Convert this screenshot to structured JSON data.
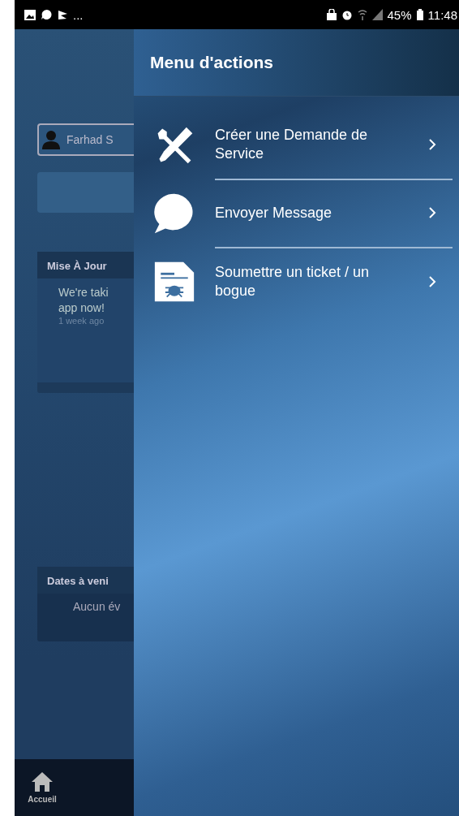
{
  "status_bar": {
    "more": "...",
    "battery": "45%",
    "time": "11:48"
  },
  "background": {
    "user": "Farhad S",
    "update_card": {
      "title": "Mise À Jour",
      "lines": [
        "We're taki",
        "app now!"
      ],
      "time": "1 week ago"
    },
    "dates_card": {
      "title": "Dates à veni",
      "text": "Aucun év"
    },
    "nav": [
      {
        "label": "Accueil",
        "kind": "home",
        "selected": true
      }
    ]
  },
  "drawer": {
    "title": "Menu d'actions",
    "items": [
      {
        "label": "Créer une Demande de Service",
        "kind": "tools"
      },
      {
        "label": "Envoyer Message",
        "kind": "chat"
      },
      {
        "label": "Soumettre un ticket / un bogue",
        "kind": "bug"
      }
    ]
  }
}
